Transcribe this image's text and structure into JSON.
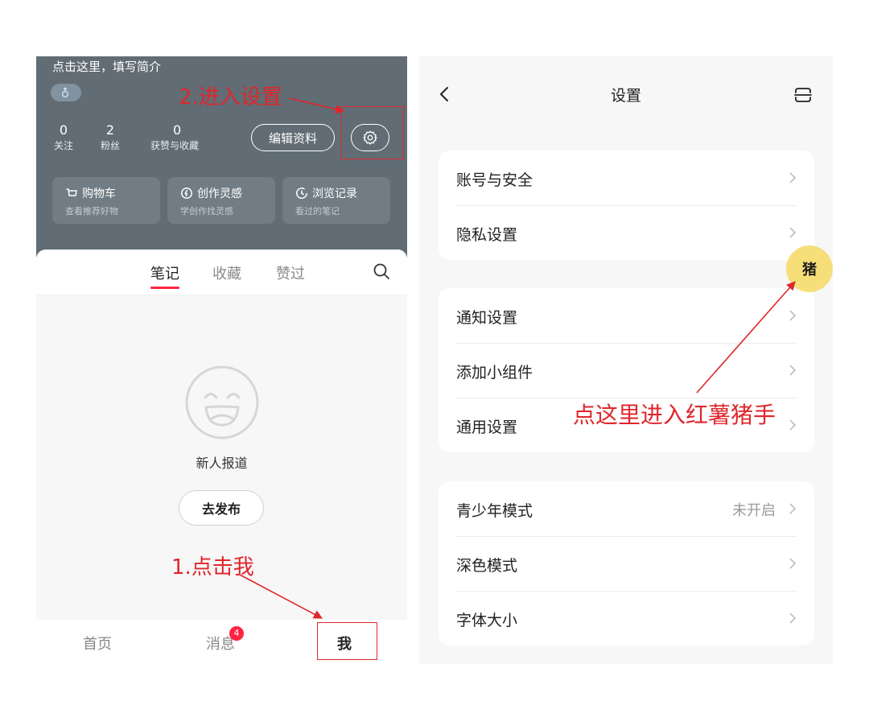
{
  "left": {
    "bio": "点击这里，填写简介",
    "stats": [
      {
        "num": "0",
        "label": "关注"
      },
      {
        "num": "2",
        "label": "粉丝"
      },
      {
        "num": "0",
        "label": "获赞与收藏"
      }
    ],
    "edit_label": "编辑资料",
    "cards": [
      {
        "icon": "cart-icon",
        "title": "购物车",
        "sub": "查看推荐好物"
      },
      {
        "icon": "lightbulb-icon",
        "title": "创作灵感",
        "sub": "学创作找灵感"
      },
      {
        "icon": "clock-icon",
        "title": "浏览记录",
        "sub": "看过的笔记"
      }
    ],
    "tabs": [
      {
        "label": "笔记",
        "active": true
      },
      {
        "label": "收藏",
        "active": false
      },
      {
        "label": "赞过",
        "active": false
      }
    ],
    "empty_text": "新人报道",
    "publish_label": "去发布",
    "nav": [
      {
        "label": "首页"
      },
      {
        "label": "消息",
        "badge": "4"
      },
      {
        "label": "我",
        "active": true
      }
    ]
  },
  "right": {
    "title": "设置",
    "groups": [
      {
        "rows": [
          {
            "label": "账号与安全"
          },
          {
            "label": "隐私设置"
          }
        ]
      },
      {
        "rows": [
          {
            "label": "通知设置"
          },
          {
            "label": "添加小组件"
          },
          {
            "label": "通用设置"
          }
        ]
      },
      {
        "rows": [
          {
            "label": "青少年模式",
            "value": "未开启"
          },
          {
            "label": "深色模式"
          },
          {
            "label": "字体大小"
          }
        ]
      }
    ],
    "pig_label": "猪"
  },
  "annotations": {
    "step2": "2.进入设置",
    "step1": "1.点击我",
    "right_note": "点这里进入红薯猪手"
  },
  "colors": {
    "annotation_red": "#e0292f",
    "profile_bg": "#616c74",
    "accent": "#ff2442",
    "pig_yellow": "#f6df78"
  }
}
